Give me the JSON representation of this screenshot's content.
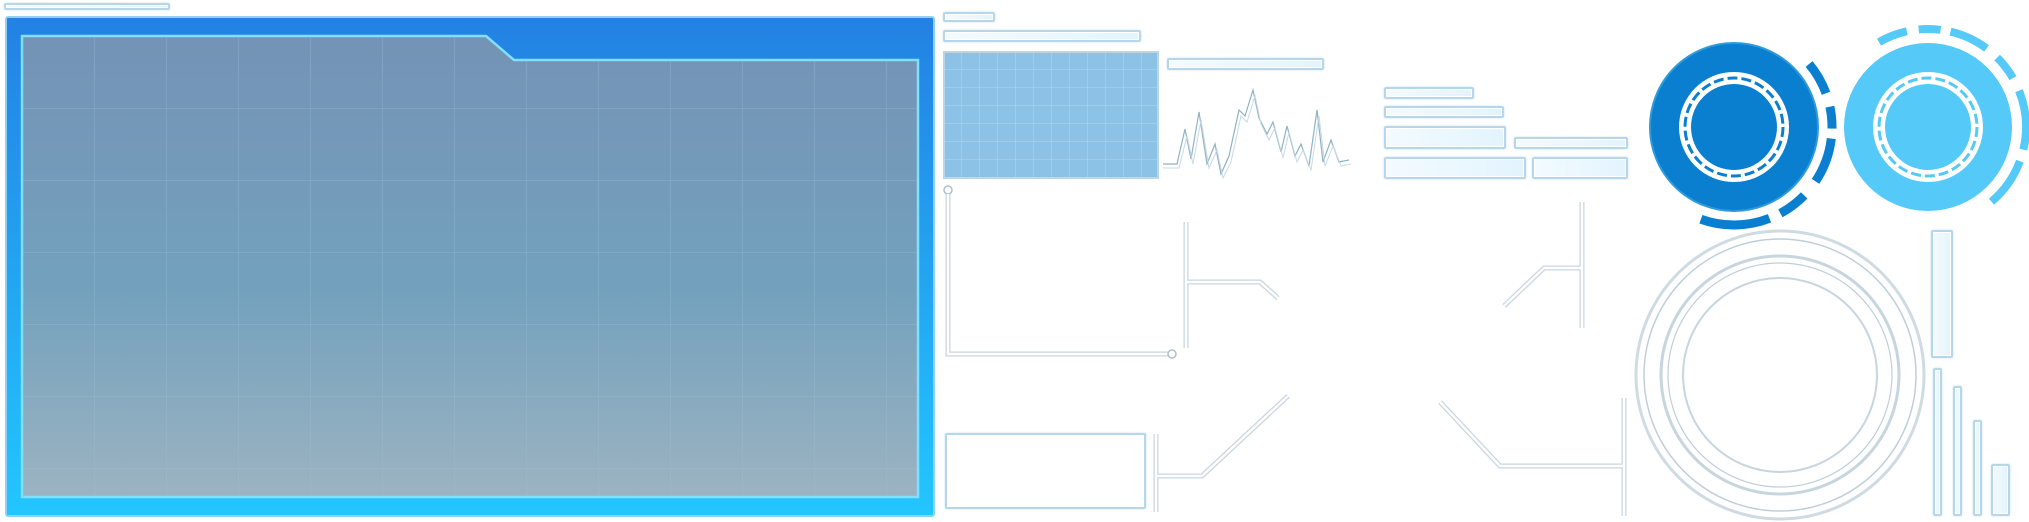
{
  "sheet": {
    "colors": {
      "panel_blue": "#2381e3",
      "panel_bright": "#23c6ff",
      "glass_top": "#7493b6",
      "glass_bottom": "#9cb3c1",
      "grid_cell": "#8cc2e6",
      "ring_dark": "#0a7fcf",
      "ring_light": "#55c9f7",
      "line_stroke": "#b3c7d4"
    },
    "icons": [
      "main-panel",
      "waveform-icon",
      "ring-gauge-icon",
      "circle-gauge-icon",
      "bar-meter-icon"
    ]
  }
}
